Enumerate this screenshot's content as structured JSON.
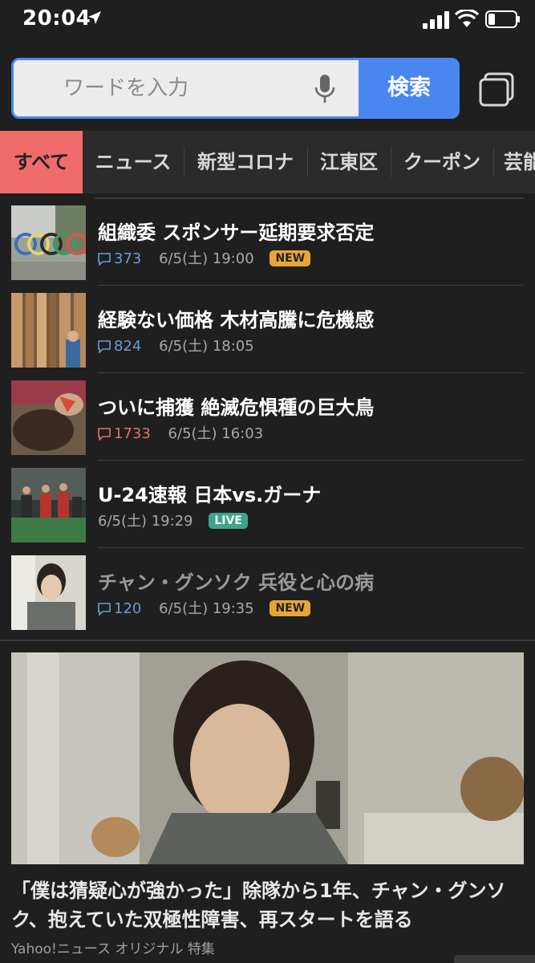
{
  "status_bar": {
    "time": "20:04"
  },
  "search": {
    "placeholder": "ワードを入力",
    "button_label": "検索"
  },
  "categories": [
    "すべて",
    "ニュース",
    "新型コロナ",
    "江東区",
    "クーポン",
    "芸能"
  ],
  "news": [
    {
      "title": "組織委 スポンサー延期要求否定",
      "comments": "373",
      "time": "6/5(土) 19:00",
      "badge": "NEW"
    },
    {
      "title": "経験ない価格 木材高騰に危機感",
      "comments": "824",
      "time": "6/5(土) 18:05",
      "badge": ""
    },
    {
      "title": "ついに捕獲 絶滅危惧種の巨大鳥",
      "comments": "1733",
      "time": "6/5(土) 16:03",
      "badge": ""
    },
    {
      "title": "U-24速報 日本vs.ガーナ",
      "comments": "",
      "time": "6/5(土) 19:29",
      "badge": "LIVE"
    },
    {
      "title": "チャン・グンソク 兵役と心の病",
      "comments": "120",
      "time": "6/5(土) 19:35",
      "badge": "NEW"
    }
  ],
  "feature": {
    "headline": "「僕は猜疑心が強かった」除隊から1年、チャン・グンソク、抱えていた双極性障害、再スタートを語る",
    "source": "Yahoo!ニュース オリジナル 特集"
  },
  "colors": {
    "accent_blue": "#4a86f0",
    "active_tab": "#f06b6b",
    "new_badge": "#e8a63a",
    "live_badge": "#3fa58a"
  }
}
